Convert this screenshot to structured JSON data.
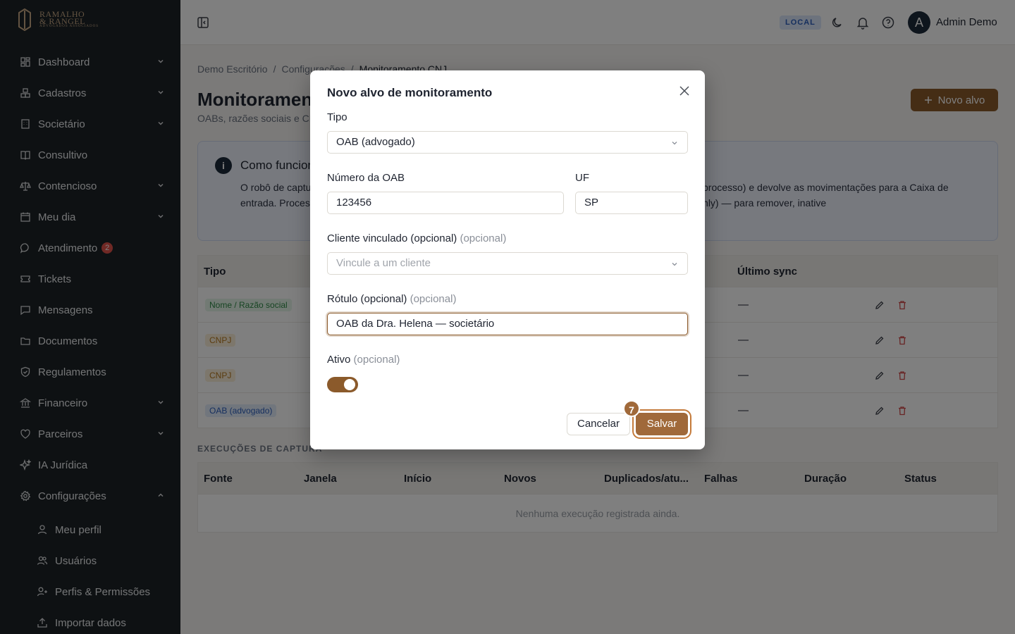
{
  "brand": {
    "line1": "RAMALHO",
    "line2": "& RANGEL",
    "tagline": "ADVOGADOS ASSOCIADOS",
    "accent": "#8b5a2b"
  },
  "sidebar": {
    "items": [
      {
        "label": "Dashboard",
        "icon": "dashboard-icon",
        "has_chevron": true
      },
      {
        "label": "Cadastros",
        "icon": "boxes-icon",
        "has_chevron": true
      },
      {
        "label": "Societário",
        "icon": "building-icon",
        "has_chevron": true
      },
      {
        "label": "Consultivo",
        "icon": "book-icon",
        "has_chevron": false
      },
      {
        "label": "Contencioso",
        "icon": "scale-icon",
        "has_chevron": true
      },
      {
        "label": "Meu dia",
        "icon": "calendar-icon",
        "has_chevron": true
      },
      {
        "label": "Atendimento",
        "icon": "chat-icon",
        "badge": "2"
      },
      {
        "label": "Tickets",
        "icon": "ticket-icon"
      },
      {
        "label": "Mensagens",
        "icon": "message-icon"
      },
      {
        "label": "Documentos",
        "icon": "folder-icon"
      },
      {
        "label": "Regulamentos",
        "icon": "shield-icon"
      },
      {
        "label": "Financeiro",
        "icon": "bank-icon",
        "has_chevron": true
      },
      {
        "label": "Parceiros",
        "icon": "handshake-icon",
        "has_chevron": true
      },
      {
        "label": "IA Jurídica",
        "icon": "sparkle-icon"
      },
      {
        "label": "Configurações",
        "icon": "gear-icon",
        "expanded": true
      }
    ],
    "sub_items": [
      {
        "label": "Meu perfil",
        "icon": "user-icon"
      },
      {
        "label": "Usuários",
        "icon": "users-icon"
      },
      {
        "label": "Perfis & Permissões",
        "icon": "user-key-icon"
      },
      {
        "label": "Importar dados",
        "icon": "upload-icon"
      }
    ]
  },
  "header": {
    "env_badge": "LOCAL",
    "user_initial": "A",
    "user_name": "Admin Demo"
  },
  "breadcrumb": [
    "Demo Escritório",
    "Configurações",
    "Monitoramento CNJ"
  ],
  "page": {
    "title": "Monitoramento CNJ",
    "subtitle": "OABs, razões sociais e CNPJs monitorados",
    "new_button": "Novo alvo"
  },
  "info": {
    "title": "Como funciona",
    "text_left": "O robô de captura consulta o CNJ pelos alvos cadastrados (OAB, razão social ou CNPJ de uma parte do processo) e devolve as movimentações para a Caixa de entrada. Processos vinculados a clientes são adicionados automaticamente como alvos herdados (read-only) — para remover, inative",
    "text_right_1": "parte do processo) e devolve as movimentações para a",
    "text_right_2": "omaticamente como alvos herdados (read-only) — para"
  },
  "targets_table": {
    "headers": {
      "tipo": "Tipo",
      "sync": "Último sync"
    },
    "rows": [
      {
        "tipo": "Nome / Razão social",
        "color": "green",
        "sync": "—"
      },
      {
        "tipo": "CNPJ",
        "color": "amber",
        "sync": "—"
      },
      {
        "tipo": "CNPJ",
        "color": "amber",
        "sync": "—"
      },
      {
        "tipo": "OAB (advogado)",
        "color": "blue",
        "sync": "—"
      }
    ]
  },
  "executions": {
    "title": "EXECUÇÕES DE CAPTURA",
    "headers": [
      "Fonte",
      "Janela",
      "Início",
      "Novos",
      "Duplicados/atu...",
      "Falhas",
      "Duração",
      "Status"
    ],
    "empty": "Nenhuma execução registrada ainda."
  },
  "modal": {
    "title": "Novo alvo de monitoramento",
    "tipo_label": "Tipo",
    "tipo_value": "OAB (advogado)",
    "oab_label": "Número da OAB",
    "oab_value": "123456",
    "uf_label": "UF",
    "uf_value": "SP",
    "cliente_label": "Cliente vinculado (opcional)",
    "cliente_opt": "(opcional)",
    "cliente_placeholder": "Vincule a um cliente",
    "rotulo_label": "Rótulo (opcional)",
    "rotulo_opt": "(opcional)",
    "rotulo_value": "OAB da Dra. Helena — societário",
    "ativo_label": "Ativo",
    "ativo_opt": "(opcional)",
    "ativo_on": true,
    "cancel": "Cancelar",
    "save": "Salvar",
    "step": "7"
  }
}
